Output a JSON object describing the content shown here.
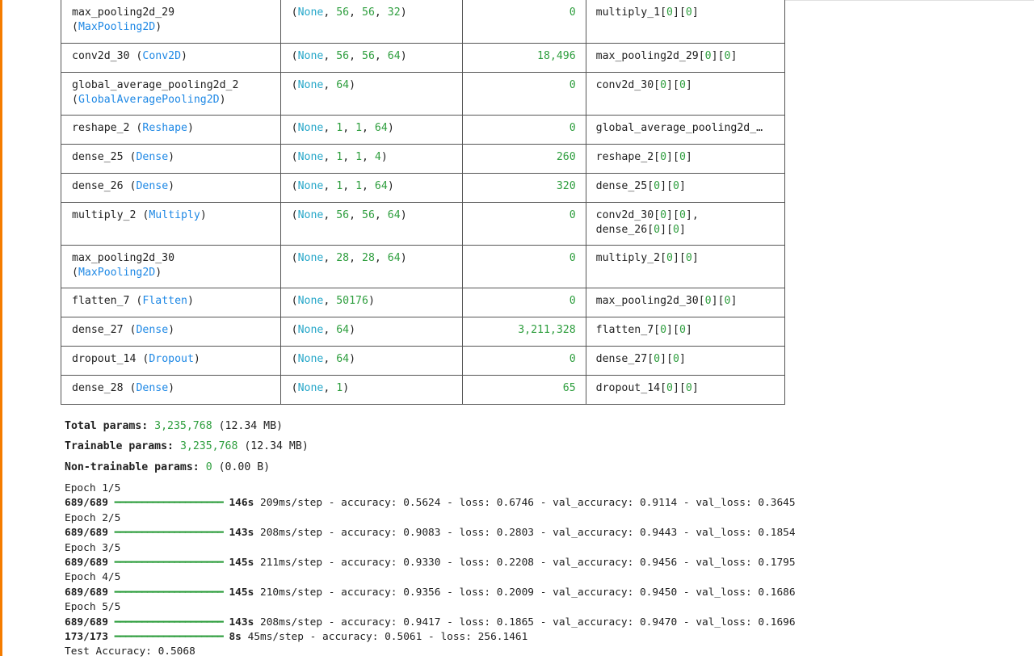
{
  "layers": [
    {
      "name": "max_pooling2d_29",
      "type": "MaxPooling2D",
      "wrap": true,
      "shape_pre": "(",
      "shape_none": "None",
      "shape_dims": [
        "56",
        "56",
        "32"
      ],
      "params": "0",
      "connected": [
        {
          "base": "multiply_1",
          "idx": [
            "0",
            "0"
          ]
        }
      ]
    },
    {
      "name": "conv2d_30",
      "type": "Conv2D",
      "wrap": false,
      "shape_none": "None",
      "shape_dims": [
        "56",
        "56",
        "64"
      ],
      "params": "18,496",
      "connected": [
        {
          "base": "max_pooling2d_29",
          "idx": [
            "0",
            "0"
          ]
        }
      ]
    },
    {
      "name": "global_average_pooling2d_2",
      "type": "GlobalAveragePooling2D",
      "wrap": true,
      "shape_none": "None",
      "shape_dims": [
        "64"
      ],
      "params": "0",
      "connected": [
        {
          "base": "conv2d_30",
          "idx": [
            "0",
            "0"
          ]
        }
      ]
    },
    {
      "name": "reshape_2",
      "type": "Reshape",
      "wrap": false,
      "shape_none": "None",
      "shape_dims": [
        "1",
        "1",
        "64"
      ],
      "params": "0",
      "connected": [
        {
          "base": "global_average_pooling2d_…",
          "idx": []
        }
      ]
    },
    {
      "name": "dense_25",
      "type": "Dense",
      "wrap": false,
      "shape_none": "None",
      "shape_dims": [
        "1",
        "1",
        "4"
      ],
      "params": "260",
      "connected": [
        {
          "base": "reshape_2",
          "idx": [
            "0",
            "0"
          ]
        }
      ]
    },
    {
      "name": "dense_26",
      "type": "Dense",
      "wrap": false,
      "shape_none": "None",
      "shape_dims": [
        "1",
        "1",
        "64"
      ],
      "params": "320",
      "connected": [
        {
          "base": "dense_25",
          "idx": [
            "0",
            "0"
          ]
        }
      ]
    },
    {
      "name": "multiply_2",
      "type": "Multiply",
      "wrap": false,
      "shape_none": "None",
      "shape_dims": [
        "56",
        "56",
        "64"
      ],
      "params": "0",
      "connected": [
        {
          "base": "conv2d_30",
          "idx": [
            "0",
            "0"
          ],
          "sep": ","
        },
        {
          "base": "dense_26",
          "idx": [
            "0",
            "0"
          ]
        }
      ]
    },
    {
      "name": "max_pooling2d_30",
      "type": "MaxPooling2D",
      "wrap": true,
      "shape_none": "None",
      "shape_dims": [
        "28",
        "28",
        "64"
      ],
      "params": "0",
      "connected": [
        {
          "base": "multiply_2",
          "idx": [
            "0",
            "0"
          ]
        }
      ]
    },
    {
      "name": "flatten_7",
      "type": "Flatten",
      "wrap": false,
      "shape_none": "None",
      "shape_dims": [
        "50176"
      ],
      "params": "0",
      "connected": [
        {
          "base": "max_pooling2d_30",
          "idx": [
            "0",
            "0"
          ]
        }
      ]
    },
    {
      "name": "dense_27",
      "type": "Dense",
      "wrap": false,
      "shape_none": "None",
      "shape_dims": [
        "64"
      ],
      "params": "3,211,328",
      "connected": [
        {
          "base": "flatten_7",
          "idx": [
            "0",
            "0"
          ]
        }
      ]
    },
    {
      "name": "dropout_14",
      "type": "Dropout",
      "wrap": false,
      "shape_none": "None",
      "shape_dims": [
        "64"
      ],
      "params": "0",
      "connected": [
        {
          "base": "dense_27",
          "idx": [
            "0",
            "0"
          ]
        }
      ]
    },
    {
      "name": "dense_28",
      "type": "Dense",
      "wrap": false,
      "shape_none": "None",
      "shape_dims": [
        "1"
      ],
      "params": "65",
      "connected": [
        {
          "base": "dropout_14",
          "idx": [
            "0",
            "0"
          ]
        }
      ]
    }
  ],
  "summary": {
    "total": {
      "label": "Total params:",
      "value": "3,235,768",
      "size": "(12.34 MB)"
    },
    "trainable": {
      "label": "Trainable params:",
      "value": "3,235,768",
      "size": "(12.34 MB)"
    },
    "non_trainable": {
      "label": "Non-trainable params:",
      "value": "0",
      "size": "(0.00 B)"
    }
  },
  "training_log": [
    {
      "epoch": "Epoch 1/5",
      "steps": "689/689",
      "bar": "━━━━━━━━━━━━━━━━━━━━",
      "time": "146s",
      "rest": "209ms/step - accuracy: 0.5624 - loss: 0.6746 - val_accuracy: 0.9114 - val_loss: 0.3645"
    },
    {
      "epoch": "Epoch 2/5",
      "steps": "689/689",
      "bar": "━━━━━━━━━━━━━━━━━━━━",
      "time": "143s",
      "rest": "208ms/step - accuracy: 0.9083 - loss: 0.2803 - val_accuracy: 0.9443 - val_loss: 0.1854"
    },
    {
      "epoch": "Epoch 3/5",
      "steps": "689/689",
      "bar": "━━━━━━━━━━━━━━━━━━━━",
      "time": "145s",
      "rest": "211ms/step - accuracy: 0.9330 - loss: 0.2208 - val_accuracy: 0.9456 - val_loss: 0.1795"
    },
    {
      "epoch": "Epoch 4/5",
      "steps": "689/689",
      "bar": "━━━━━━━━━━━━━━━━━━━━",
      "time": "145s",
      "rest": "210ms/step - accuracy: 0.9356 - loss: 0.2009 - val_accuracy: 0.9450 - val_loss: 0.1686"
    },
    {
      "epoch": "Epoch 5/5",
      "steps": "689/689",
      "bar": "━━━━━━━━━━━━━━━━━━━━",
      "time": "143s",
      "rest": "208ms/step - accuracy: 0.9417 - loss: 0.1865 - val_accuracy: 0.9470 - val_loss: 0.1696"
    }
  ],
  "evaluation": {
    "steps": "173/173",
    "bar": "━━━━━━━━━━━━━━━━━━━━",
    "time": "8s",
    "rest": "45ms/step - accuracy: 0.5061 - loss: 256.1461"
  },
  "test_accuracy": "Test Accuracy: 0.5068"
}
